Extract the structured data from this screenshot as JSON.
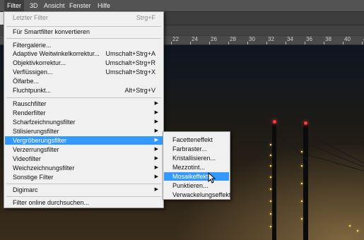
{
  "menubar": {
    "items": [
      {
        "label": "Filter",
        "active": true
      },
      {
        "label": "3D"
      },
      {
        "label": "Ansicht"
      },
      {
        "label": "Fenster"
      },
      {
        "label": "Hilfe"
      }
    ]
  },
  "ruler": {
    "ticks": [
      "22",
      "24",
      "26",
      "28",
      "30",
      "32",
      "34",
      "36",
      "38",
      "40",
      "42"
    ]
  },
  "filter_menu": {
    "items": [
      {
        "label": "Letzter Filter",
        "shortcut": "Strg+F",
        "disabled": true
      },
      {
        "label": "Für Smartfilter konvertieren"
      },
      {
        "label": "Filtergalerie..."
      },
      {
        "label": "Adaptive Weitwinkelkorrektur...",
        "shortcut": "Umschalt+Strg+A"
      },
      {
        "label": "Objektivkorrektur...",
        "shortcut": "Umschalt+Strg+R"
      },
      {
        "label": "Verflüssigen...",
        "shortcut": "Umschalt+Strg+X"
      },
      {
        "label": "Ölfarbe..."
      },
      {
        "label": "Fluchtpunkt...",
        "shortcut": "Alt+Strg+V"
      },
      {
        "label": "Rauschfilter"
      },
      {
        "label": "Renderfilter"
      },
      {
        "label": "Scharfzeichnungsfilter"
      },
      {
        "label": "Stilisierungsfilter"
      },
      {
        "label": "Vergröberungsfilter",
        "highlighted": true
      },
      {
        "label": "Verzerrungsfilter"
      },
      {
        "label": "Videofilter"
      },
      {
        "label": "Weichzeichnungsfilter"
      },
      {
        "label": "Sonstige Filter"
      },
      {
        "label": "Digimarc"
      },
      {
        "label": "Filter online durchsuchen..."
      }
    ],
    "submenu_arrow": "▶"
  },
  "submenu": {
    "items": [
      {
        "label": "Facetteneffekt"
      },
      {
        "label": "Farbraster..."
      },
      {
        "label": "Kristallisieren..."
      },
      {
        "label": "Mezzotint..."
      },
      {
        "label": "Mosaikeffekt...",
        "highlighted": true
      },
      {
        "label": "Punktieren..."
      },
      {
        "label": "Verwackelungseffekt"
      }
    ]
  },
  "colors": {
    "highlight": "#3399ff",
    "menu_bg": "#f0f0f0",
    "menubar_bg": "#535353"
  }
}
